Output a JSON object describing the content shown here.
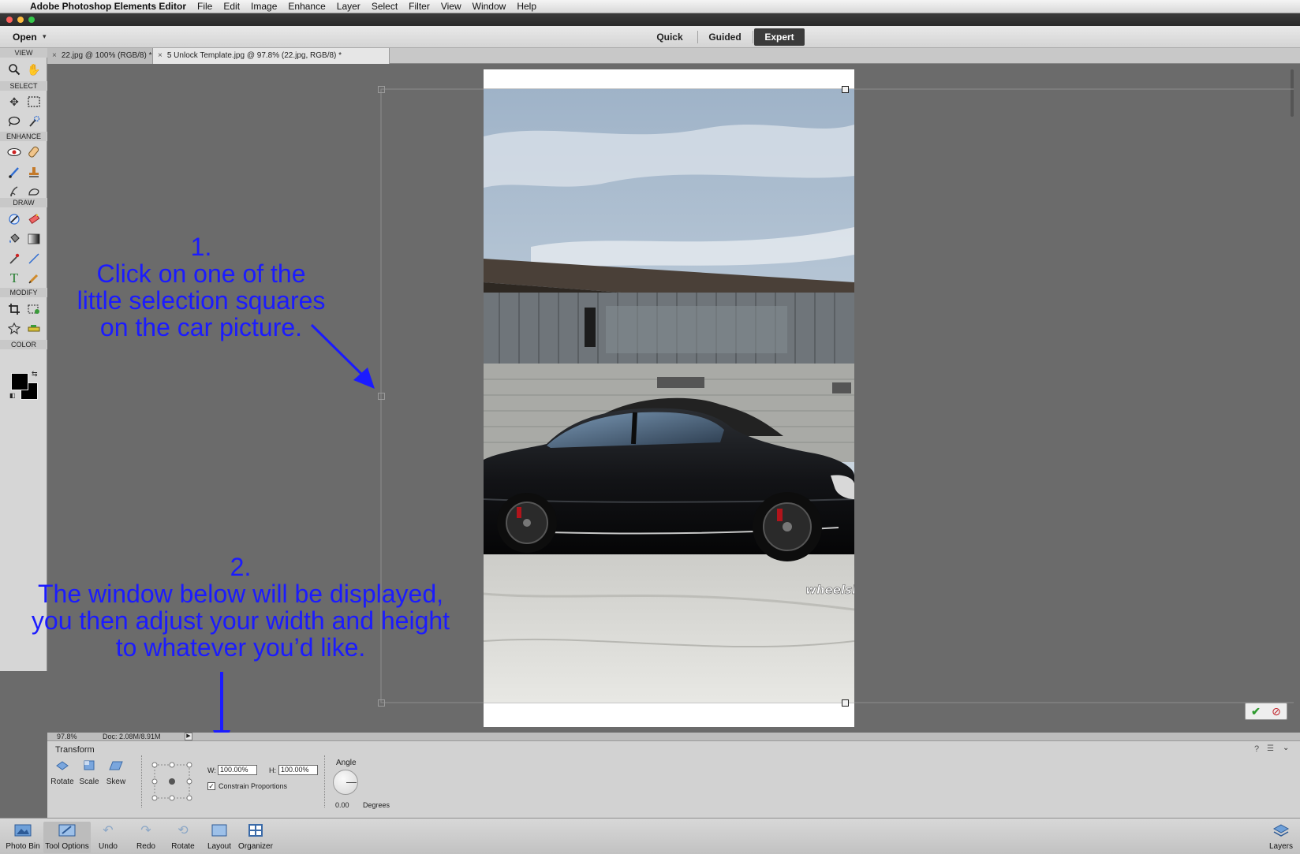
{
  "menubar": {
    "app_name": "Adobe Photoshop Elements Editor",
    "items": [
      "File",
      "Edit",
      "Image",
      "Enhance",
      "Layer",
      "Select",
      "Filter",
      "View",
      "Window",
      "Help"
    ]
  },
  "topbar": {
    "open_label": "Open",
    "modes": {
      "quick": "Quick",
      "guided": "Guided",
      "expert": "Expert"
    },
    "active_mode": "Expert"
  },
  "tabs": [
    {
      "label": "22.jpg @ 100% (RGB/8) *",
      "active": false
    },
    {
      "label": "5 Unlock Template.jpg @ 97.8% (22.jpg, RGB/8) *",
      "active": true
    }
  ],
  "toolbox": {
    "sections": {
      "view": "VIEW",
      "select": "SELECT",
      "enhance": "ENHANCE",
      "draw": "DRAW",
      "modify": "MODIFY",
      "color": "COLOR"
    },
    "foreground_color": "#000000",
    "background_color": "#000000"
  },
  "annotations": {
    "step1": [
      "1.",
      "Click on one of the",
      "little selection squares",
      "on the car picture."
    ],
    "step2": [
      "2.",
      "The window below will be displayed,",
      "you then adjust your width and height",
      "to whatever you’d like."
    ],
    "color": "#1b1bff"
  },
  "status": {
    "zoom": "97.8%",
    "doc": "Doc: 2.08M/8.91M"
  },
  "options": {
    "title": "Transform",
    "modes": [
      "Rotate",
      "Scale",
      "Skew"
    ],
    "width_label": "W:",
    "width_value": "100.00%",
    "height_label": "H:",
    "height_value": "100.00%",
    "constrain_label": "Constrain Proportions",
    "constrain_checked": true,
    "angle_label": "Angle",
    "angle_value": "0.00",
    "angle_unit": "Degrees"
  },
  "bottombar": {
    "items": [
      "Photo Bin",
      "Tool Options",
      "Undo",
      "Redo",
      "Rotate",
      "Layout",
      "Organizer"
    ],
    "layers": "Layers"
  }
}
